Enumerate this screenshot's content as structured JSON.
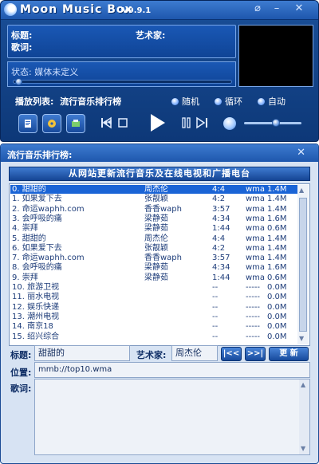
{
  "player": {
    "title": "Moon Music Box",
    "version": "V9.9.1",
    "title_label": "标题:",
    "artist_label": "艺术家:",
    "lyrics_label": "歌词:",
    "status_label": "状态:",
    "status_value": "媒体未定义",
    "playlist_label": "播放列表:",
    "playlist_name": "流行音乐排行榜",
    "modes": [
      "随机",
      "循环",
      "自动"
    ],
    "progress": 0.02,
    "volume": 0.55
  },
  "playlist_window": {
    "title": "流行音乐排行榜:",
    "header": "从网站更新流行音乐及在线电视和广播电台",
    "tracks": [
      {
        "name": "0. 甜甜的",
        "artist": "周杰伦",
        "duration": "4:4",
        "format": "wma",
        "size": "1.4M",
        "selected": true
      },
      {
        "name": "1. 如果爱下去",
        "artist": "张靓颖",
        "duration": "4:2",
        "format": "wma",
        "size": "1.4M"
      },
      {
        "name": "2. 命运waphh.com",
        "artist": "香香waph",
        "duration": "3:57",
        "format": "wma",
        "size": "1.4M"
      },
      {
        "name": "3. 会呼吸的痛",
        "artist": "梁静茹",
        "duration": "4:34",
        "format": "wma",
        "size": "1.6M"
      },
      {
        "name": "4. 崇拜",
        "artist": "梁静茹",
        "duration": "1:44",
        "format": "wma",
        "size": "0.6M"
      },
      {
        "name": "5. 甜甜的",
        "artist": "周杰伦",
        "duration": "4:4",
        "format": "wma",
        "size": "1.4M"
      },
      {
        "name": "6. 如果爱下去",
        "artist": "张靓颖",
        "duration": "4:2",
        "format": "wma",
        "size": "1.4M"
      },
      {
        "name": "7. 命运waphh.com",
        "artist": "香香waph",
        "duration": "3:57",
        "format": "wma",
        "size": "1.4M"
      },
      {
        "name": "8. 会呼吸的痛",
        "artist": "梁静茹",
        "duration": "4:34",
        "format": "wma",
        "size": "1.6M"
      },
      {
        "name": "9. 崇拜",
        "artist": "梁静茹",
        "duration": "1:44",
        "format": "wma",
        "size": "0.6M"
      },
      {
        "name": "10. 旅游卫视",
        "artist": "",
        "duration": "--",
        "format": "-----",
        "size": "0.0M"
      },
      {
        "name": "11. 丽水电视",
        "artist": "",
        "duration": "--",
        "format": "-----",
        "size": "0.0M"
      },
      {
        "name": "12. 娱乐快递",
        "artist": "",
        "duration": "--",
        "format": "-----",
        "size": "0.0M"
      },
      {
        "name": "13. 潮州电视",
        "artist": "",
        "duration": "--",
        "format": "-----",
        "size": "0.0M"
      },
      {
        "name": "14. 南京18",
        "artist": "",
        "duration": "--",
        "format": "-----",
        "size": "0.0M"
      },
      {
        "name": "15. 绍兴综合",
        "artist": "",
        "duration": "--",
        "format": "-----",
        "size": "0.0M"
      }
    ],
    "title_label": "标题:",
    "title_value": "甜甜的",
    "artist_label": "艺术家:",
    "artist_value": "周杰伦",
    "prev_button": "|<<",
    "next_button": ">>|",
    "update_button": "更 新",
    "location_label": "位置:",
    "location_value": "mmb://top10.wma",
    "lyrics_label": "歌词:"
  }
}
